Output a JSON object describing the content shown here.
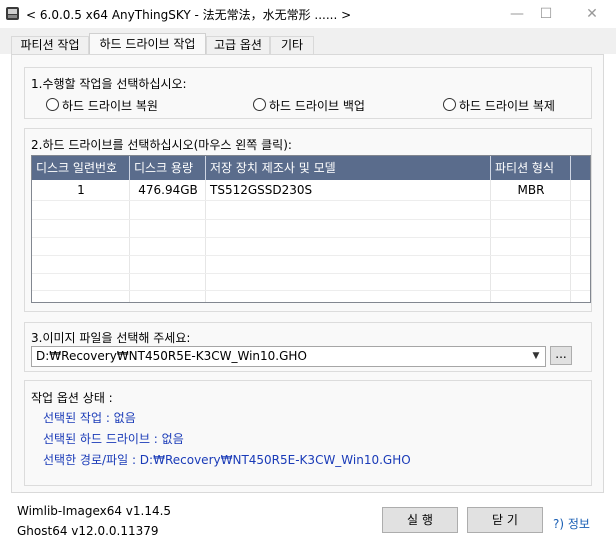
{
  "window": {
    "title": "< 6.0.0.5 x64 AnyThingSKY - 法无常法，水无常形 ...... >",
    "minimize": "—",
    "maximize": "☐",
    "close": "✕"
  },
  "tabs": [
    {
      "label": "파티션 작업"
    },
    {
      "label": "하드 드라이브 작업"
    },
    {
      "label": "고급 옵션"
    },
    {
      "label": "기타"
    }
  ],
  "section1": {
    "title": "1.수행할 작업을 선택하십시오:",
    "options": [
      {
        "label": "하드 드라이브 복원"
      },
      {
        "label": "하드 드라이브 백업"
      },
      {
        "label": "하드 드라이브 복제"
      }
    ]
  },
  "section2": {
    "title": "2.하드 드라이브를 선택하십시오(마우스 왼쪽 클릭):",
    "columns": [
      "디스크 일련번호",
      "디스크 용량",
      "저장 장치 제조사 및 모델",
      "파티션 형식"
    ],
    "rows": [
      [
        "1",
        "476.94GB",
        "TS512GSSD230S",
        "MBR"
      ]
    ]
  },
  "section3": {
    "title": "3.이미지 파일을 선택해 주세요:",
    "path": "D:₩Recovery₩NT450R5E-K3CW_Win10.GHO",
    "browse": "..."
  },
  "status": {
    "title": "작업 옵션 상태 :",
    "lines": [
      "선택된 작업 : 없음",
      "선택된 하드 드라이브 : 없음",
      "선택한 경로/파일 : D:₩Recovery₩NT450R5E-K3CW_Win10.GHO"
    ]
  },
  "footer": {
    "wimlib": "Wimlib-Imagex64 v1.14.5",
    "ghost": "Ghost64 v12.0.0.11379",
    "run": "실 행",
    "close": "닫 기",
    "info": "?) 정보"
  }
}
